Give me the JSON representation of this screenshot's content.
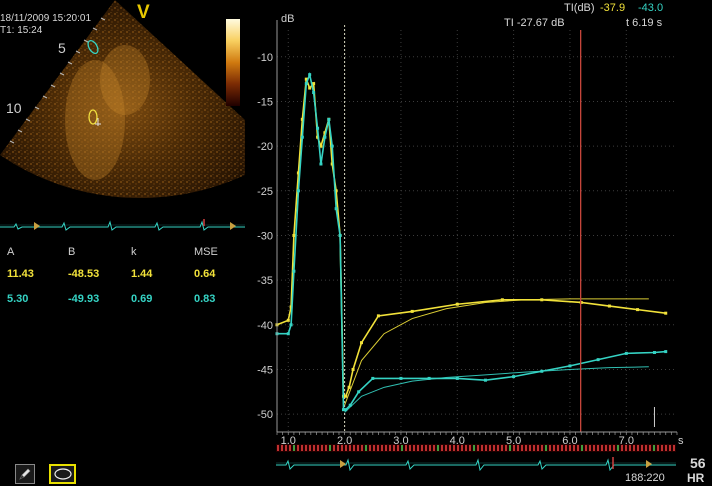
{
  "scan": {
    "timestamp": "18/11/2009 15:20:01",
    "t1": "T1: 15:24",
    "view_marker": "V",
    "depth_labels": [
      "5",
      "10"
    ]
  },
  "fit_table": {
    "headers": [
      "A",
      "B",
      "k",
      "MSE"
    ],
    "rows": [
      {
        "values": [
          "11.43",
          "-48.53",
          "1.44",
          "0.64"
        ],
        "color": "#f2e23a"
      },
      {
        "values": [
          "5.30",
          "-49.93",
          "0.69",
          "0.83"
        ],
        "color": "#35d3c4"
      }
    ]
  },
  "tools": [
    {
      "name": "pencil-icon",
      "selected": false
    },
    {
      "name": "ellipse-roi-icon",
      "selected": true
    }
  ],
  "readout": {
    "ti_label": "TI(dB)",
    "ti_yellow": "-37.9",
    "ti_cyan": "-43.0",
    "ti_cursor": "TI -27.67 dB",
    "time_cursor": "t 6.19 s"
  },
  "hr": {
    "value": "56",
    "label": "HR",
    "frame": "188:220"
  },
  "colors": {
    "yellow": "#f2e23a",
    "cyan": "#35d3c4",
    "cursor": "#c8463c",
    "grid": "#3c3c3c"
  },
  "chart_data": {
    "type": "line",
    "ylabel": "dB",
    "xlabel": "s",
    "xlim": [
      0.8,
      7.9
    ],
    "ylim": [
      -52,
      -7
    ],
    "x_ticks": [
      "1.0",
      "2.0",
      "3.0",
      "4.0",
      "5.0",
      "6.0",
      "7.0"
    ],
    "y_ticks": [
      "-10",
      "-15",
      "-20",
      "-25",
      "-30",
      "-35",
      "-40",
      "-45",
      "-50"
    ],
    "cursor_x": 6.19,
    "series": [
      {
        "color": "#f2e23a",
        "x": [
          0.8,
          1.0,
          1.05,
          1.1,
          1.18,
          1.25,
          1.32,
          1.38,
          1.45,
          1.52,
          1.58,
          1.65,
          1.72,
          1.78,
          1.85,
          1.92,
          1.98,
          2.02,
          2.08,
          2.15,
          2.3,
          2.6,
          3.2,
          4.0,
          4.8,
          5.5,
          6.2,
          6.7,
          7.2,
          7.7
        ],
        "y": [
          -40,
          -39.5,
          -38,
          -30,
          -23,
          -17,
          -12.5,
          -13.5,
          -13,
          -19,
          -20,
          -18.5,
          -17,
          -22,
          -25,
          -30,
          -48,
          -48,
          -47,
          -45,
          -42,
          -39,
          -38.5,
          -37.7,
          -37.2,
          -37.2,
          -37.5,
          -37.9,
          -38.3,
          -38.7
        ],
        "fit_x": [
          2.0,
          2.3,
          2.7,
          3.2,
          3.8,
          4.5,
          5.2,
          6.0,
          6.7,
          7.4
        ],
        "fit_y": [
          -49,
          -44,
          -41,
          -39.3,
          -38.2,
          -37.5,
          -37.2,
          -37.1,
          -37.1,
          -37.1
        ]
      },
      {
        "color": "#35d3c4",
        "x": [
          0.8,
          1.0,
          1.05,
          1.1,
          1.18,
          1.25,
          1.32,
          1.38,
          1.45,
          1.52,
          1.58,
          1.65,
          1.72,
          1.78,
          1.85,
          1.92,
          1.98,
          2.02,
          2.1,
          2.25,
          2.5,
          3.0,
          3.5,
          4.0,
          4.5,
          5.0,
          5.5,
          6.0,
          6.5,
          7.0,
          7.5,
          7.7
        ],
        "y": [
          -41,
          -41,
          -40,
          -34,
          -25,
          -19,
          -13,
          -12,
          -14,
          -18,
          -22,
          -19,
          -17,
          -20,
          -27,
          -30,
          -49.5,
          -49.5,
          -49,
          -47.5,
          -46,
          -46,
          -46,
          -46,
          -46.2,
          -45.8,
          -45.2,
          -44.6,
          -43.9,
          -43.2,
          -43.1,
          -43.0
        ],
        "fit_x": [
          2.0,
          2.3,
          2.7,
          3.2,
          3.8,
          4.5,
          5.2,
          6.0,
          6.7,
          7.4
        ],
        "fit_y": [
          -49.8,
          -48,
          -47,
          -46.3,
          -45.9,
          -45.6,
          -45.3,
          -45.0,
          -44.8,
          -44.7
        ]
      }
    ]
  }
}
